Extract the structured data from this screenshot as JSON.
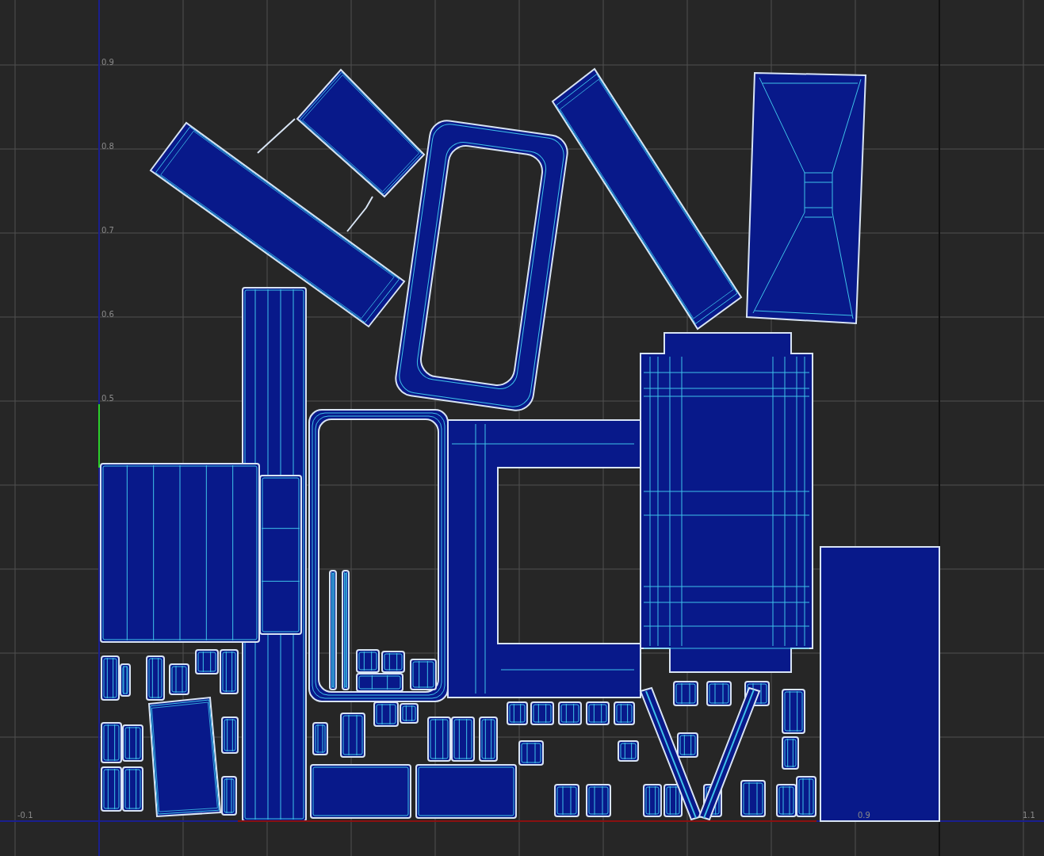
{
  "uv_editor": {
    "v_axis_labels": [
      "0.9",
      "0.8",
      "0.7",
      "0.6",
      "0.5"
    ],
    "u_axis_labels": [
      "-0.1",
      "0.9",
      "1.1"
    ]
  }
}
